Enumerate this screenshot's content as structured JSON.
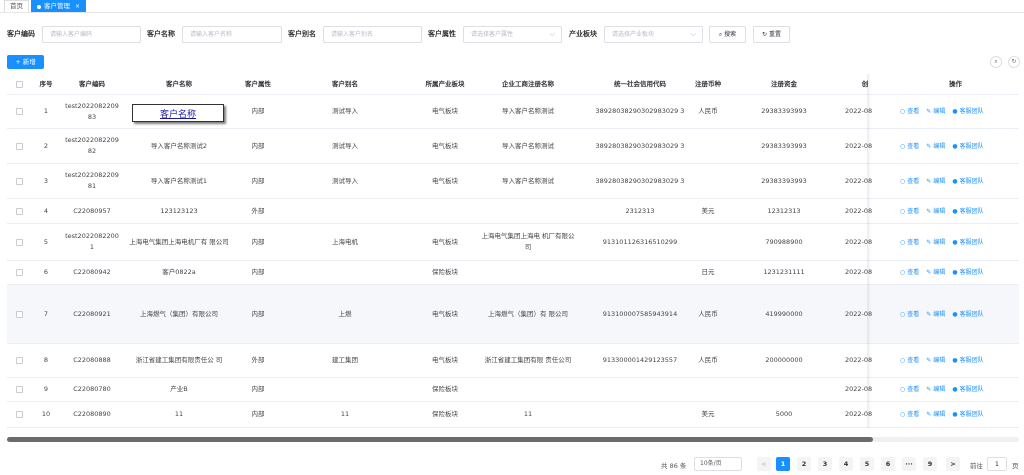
{
  "tabs": [
    {
      "label": "首页",
      "active": false
    },
    {
      "label": "客户管理",
      "active": true
    }
  ],
  "search": {
    "code_label": "客户编码",
    "code_placeholder": "请输入客户编码",
    "name_label": "客户名称",
    "name_placeholder": "请输入客户名称",
    "alias_label": "客户别名",
    "alias_placeholder": "请输入客户别名",
    "attr_label": "客户属性",
    "attr_placeholder": "请选择客户属性",
    "sector_label": "产业板块",
    "sector_placeholder": "请选择产业板块",
    "search_btn": "搜索",
    "reset_btn": "重置"
  },
  "toolbar": {
    "add_btn": "+ 新增"
  },
  "table": {
    "headers": {
      "index": "序号",
      "code": "客户编码",
      "name": "客户名称",
      "attr": "客户属性",
      "alias": "客户别名",
      "sector": "所属产业板块",
      "reg_name": "企业工商注册名称",
      "credit": "统一社会信用代码",
      "currency": "注册币种",
      "capital": "注册资金",
      "date": "创",
      "ops": "操作"
    },
    "rows": [
      {
        "index": "1",
        "code": "test2022082209 83",
        "name": "",
        "attr": "内部",
        "alias": "测试导入",
        "sector": "电气板块",
        "reg_name": "导入客户名称测试",
        "credit": "38928038290302983029 3",
        "currency": "人民币",
        "capital": "29383393993",
        "date": "2022-08"
      },
      {
        "index": "2",
        "code": "test2022082209 82",
        "name": "导入客户名称测试2",
        "attr": "内部",
        "alias": "测试导入",
        "sector": "电气板块",
        "reg_name": "导入客户名称测试",
        "credit": "38928038290302983029 3",
        "currency": "",
        "capital": "29383393993",
        "date": "2022-08"
      },
      {
        "index": "3",
        "code": "test2022082209 81",
        "name": "导入客户名称测试1",
        "attr": "内部",
        "alias": "测试导入",
        "sector": "电气板块",
        "reg_name": "导入客户名称测试",
        "credit": "38928038290302983029 3",
        "currency": "",
        "capital": "29383393993",
        "date": "2022-08"
      },
      {
        "index": "4",
        "code": "C22080957",
        "name": "123123123",
        "attr": "外部",
        "alias": "",
        "sector": "",
        "reg_name": "",
        "credit": "2312313",
        "currency": "美元",
        "capital": "12312313",
        "date": "2022-08"
      },
      {
        "index": "5",
        "code": "test2022082200 1",
        "name": "上海电气集团上海电机厂有 限公司",
        "attr": "内部",
        "alias": "上海电机",
        "sector": "电气板块",
        "reg_name": "上海电气集团上海电 机厂有限公司",
        "credit": "913101126316510299",
        "currency": "",
        "capital": "790988900",
        "date": "2022-08"
      },
      {
        "index": "6",
        "code": "C22080942",
        "name": "客户0822a",
        "attr": "内部",
        "alias": "",
        "sector": "保险板块",
        "reg_name": "",
        "credit": "",
        "currency": "日元",
        "capital": "1231231111",
        "date": "2022-08"
      },
      {
        "index": "7",
        "code": "C22080921",
        "name": "上海燃气（集团）有限公司",
        "attr": "内部",
        "alias": "上燃",
        "sector": "电气板块",
        "reg_name": "上海燃气（集团）有 限公司",
        "credit": "913100007585943914",
        "currency": "人民币",
        "capital": "419990000",
        "date": "2022-08"
      },
      {
        "index": "8",
        "code": "C22080888",
        "name": "浙江省建工集团有限责任公 司",
        "attr": "外部",
        "alias": "建工集团",
        "sector": "电气板块",
        "reg_name": "浙江省建工集团有限 责任公司",
        "credit": "913300001429123557",
        "currency": "人民币",
        "capital": "200000000",
        "date": "2022-08"
      },
      {
        "index": "9",
        "code": "C22080780",
        "name": "产业B",
        "attr": "内部",
        "alias": "",
        "sector": "保险板块",
        "reg_name": "",
        "credit": "",
        "currency": "",
        "capital": "",
        "date": "2022-08"
      },
      {
        "index": "10",
        "code": "C22080890",
        "name": "11",
        "attr": "内部",
        "alias": "11",
        "sector": "保险板块",
        "reg_name": "11",
        "credit": "",
        "currency": "美元",
        "capital": "5000",
        "date": "2022-08"
      }
    ],
    "ops": {
      "view": "查看",
      "edit": "编辑",
      "team": "客服团队"
    }
  },
  "tooltip": {
    "text": "客户名称"
  },
  "pagination": {
    "total": "共 86 条",
    "page_size": "10条/页",
    "prev": "<",
    "next": ">",
    "pages": [
      "1",
      "2",
      "3",
      "4",
      "5",
      "6",
      "···",
      "9"
    ],
    "current": "1",
    "goto_label": "前往",
    "goto_value": "1",
    "page_unit": "页"
  }
}
